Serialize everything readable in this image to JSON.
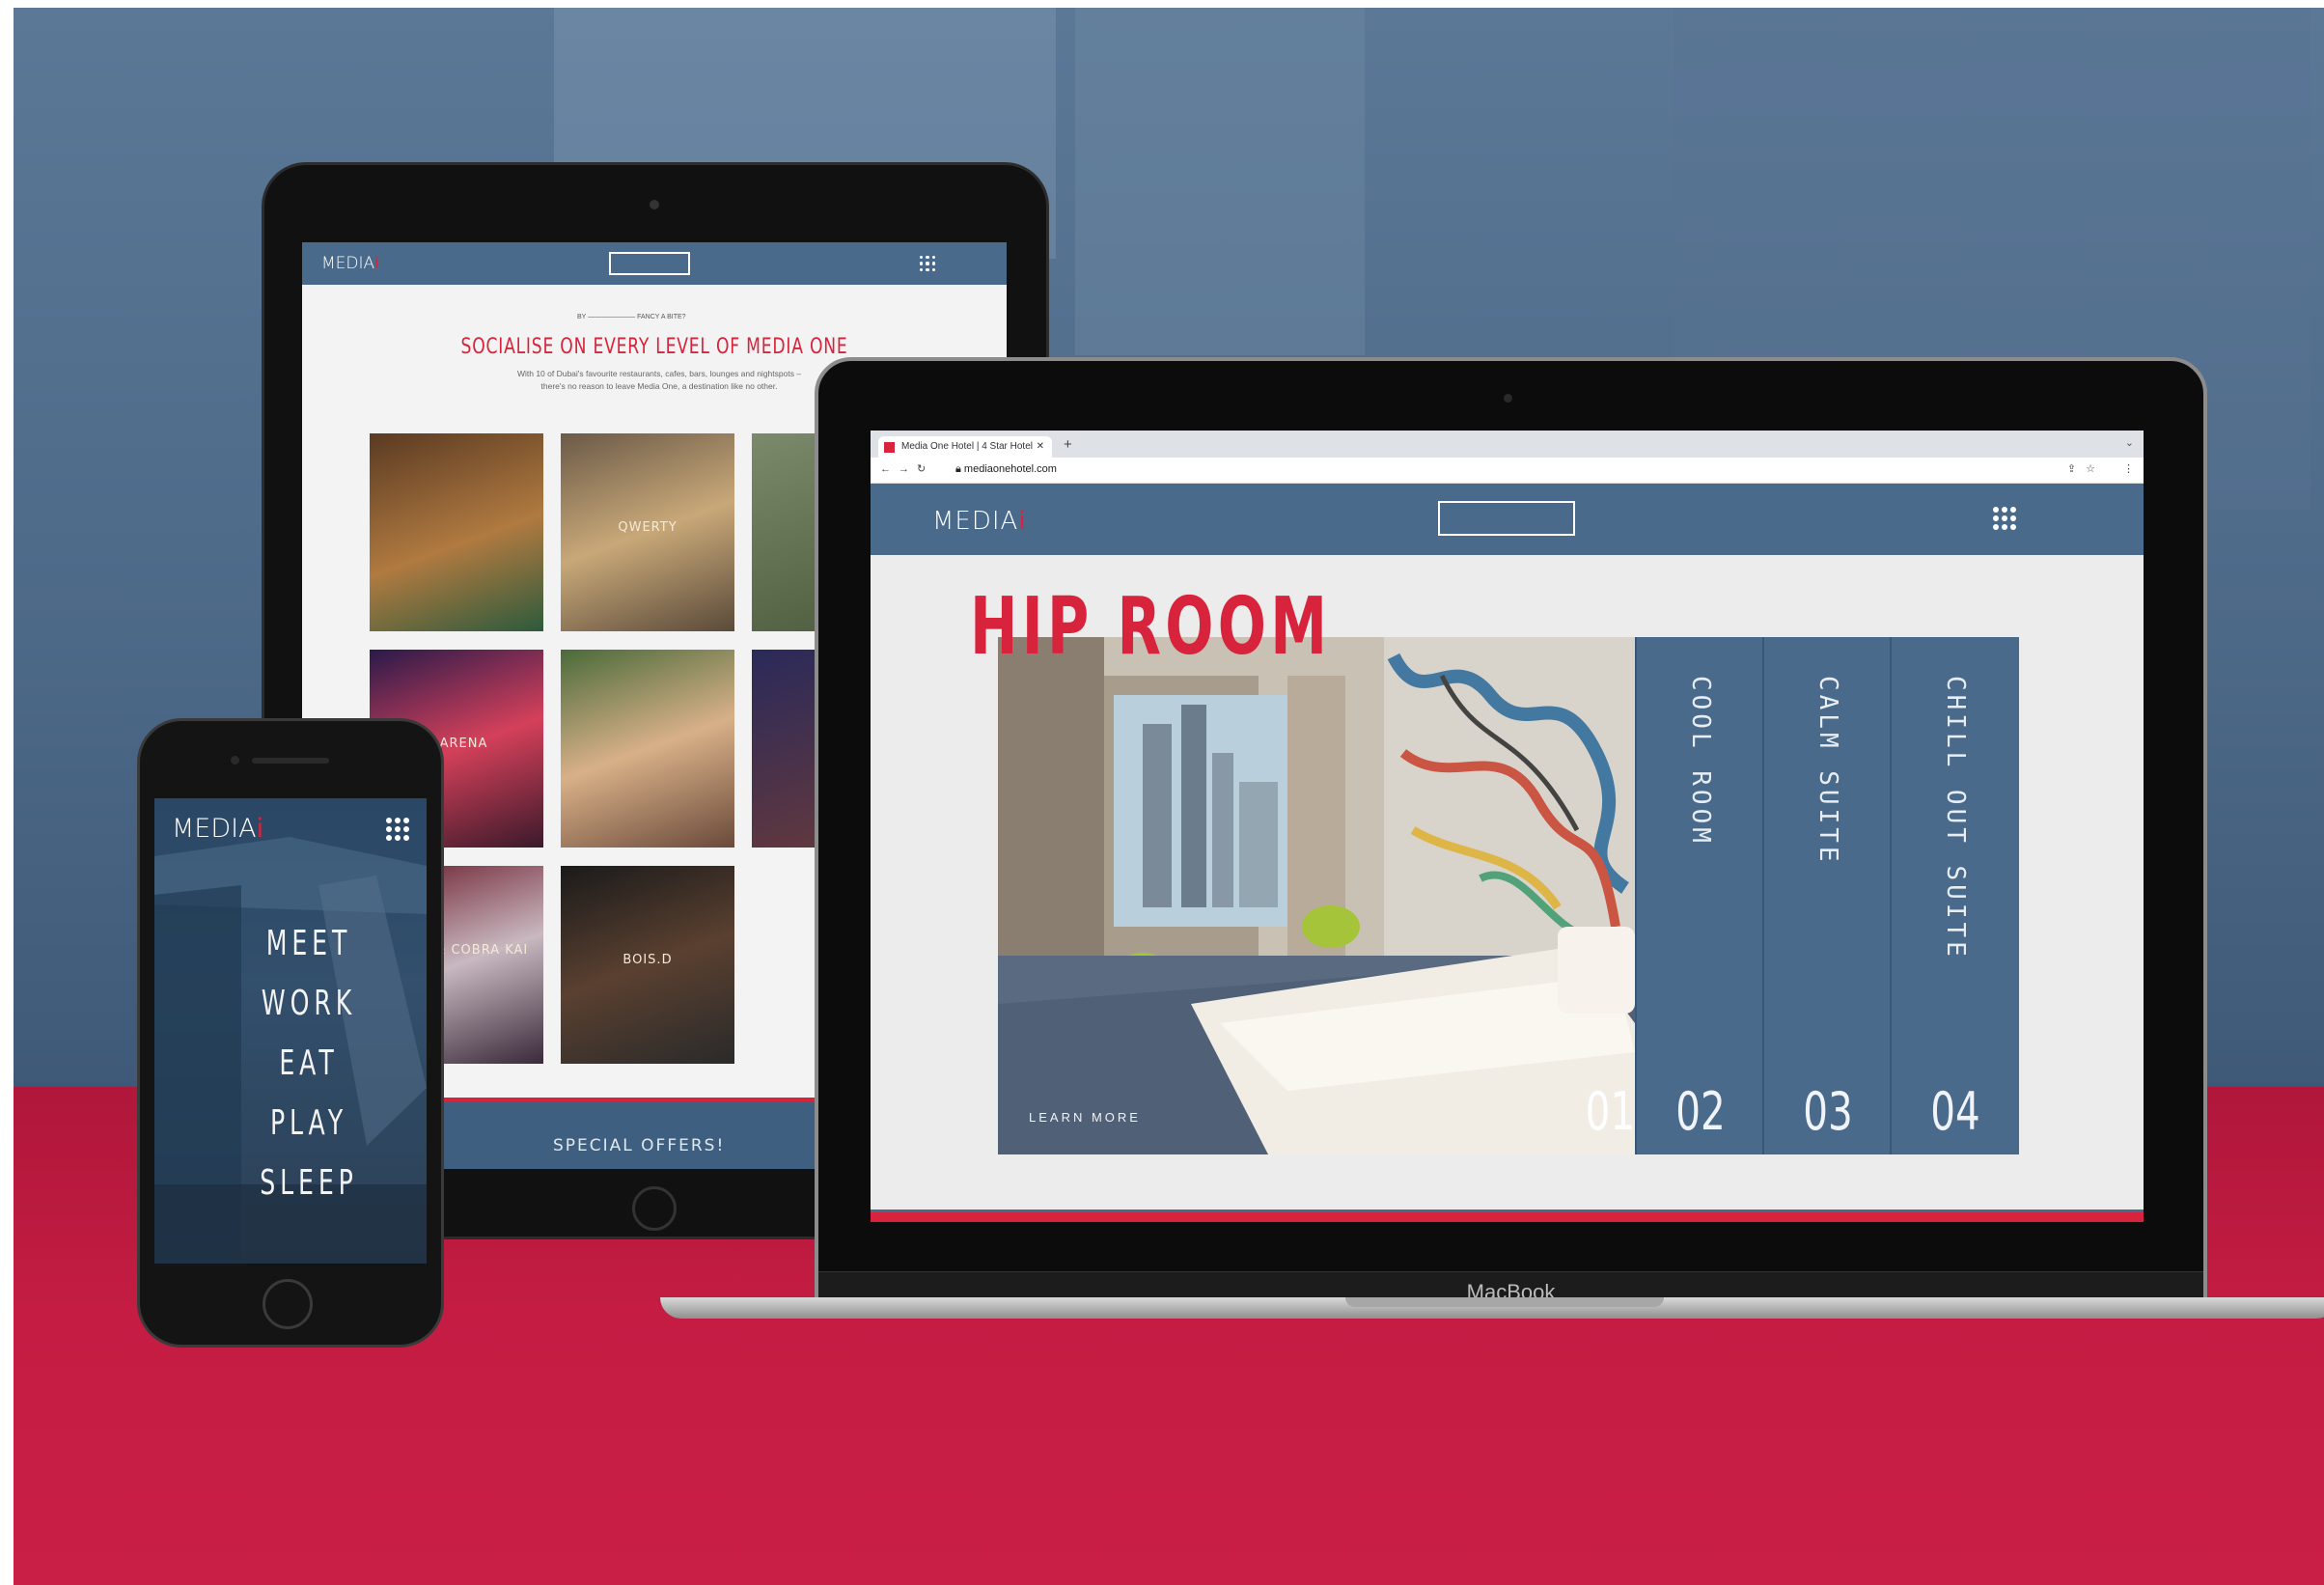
{
  "colors": {
    "brand_red": "#d8233c",
    "brand_blue": "#4a6a8c",
    "floor_red": "#c41c43"
  },
  "tablet": {
    "logo_main": "MEDIA",
    "logo_accent": "i",
    "kicker": "BY ——————— FANCY A BITE?",
    "title": "SOCIALISE ON EVERY LEVEL OF MEDIA ONE",
    "description": "With 10 of Dubai's favourite restaurants, cafes, bars, lounges and nightspots – there's no reason to leave Media One, a destination like no other.",
    "tiles": [
      {
        "label": ""
      },
      {
        "label": "QWERTY"
      },
      {
        "label": ""
      },
      {
        "label": "Z ARENA"
      },
      {
        "label": ""
      },
      {
        "label": ""
      },
      {
        "label": "YAGI'S & COBRA KAI"
      },
      {
        "label": "BOIS.D"
      }
    ],
    "footer": "SPECIAL OFFERS!"
  },
  "laptop": {
    "tab_title": "Media One Hotel | 4 Star Hotel",
    "url": "mediaonehotel.com",
    "logo_main": "MEDIA",
    "logo_accent": "i",
    "hero_title": "HIP ROOM",
    "learn_more": "LEARN MORE",
    "hero_number": "01",
    "panels": [
      {
        "label": "COOL ROOM",
        "number": "02"
      },
      {
        "label": "CALM SUITE",
        "number": "03"
      },
      {
        "label": "CHILL OUT SUITE",
        "number": "04"
      }
    ],
    "brand": "MacBook"
  },
  "phone": {
    "logo_main": "MEDIA",
    "logo_accent": "i",
    "words": [
      "MEET",
      "WORK",
      "EAT",
      "PLAY",
      "SLEEP"
    ]
  },
  "icons": [
    "grid-menu-icon",
    "close-icon",
    "plus-icon",
    "back-icon",
    "forward-icon",
    "reload-icon",
    "lock-icon",
    "share-icon",
    "star-icon",
    "more-icon",
    "chevron-down-icon"
  ]
}
